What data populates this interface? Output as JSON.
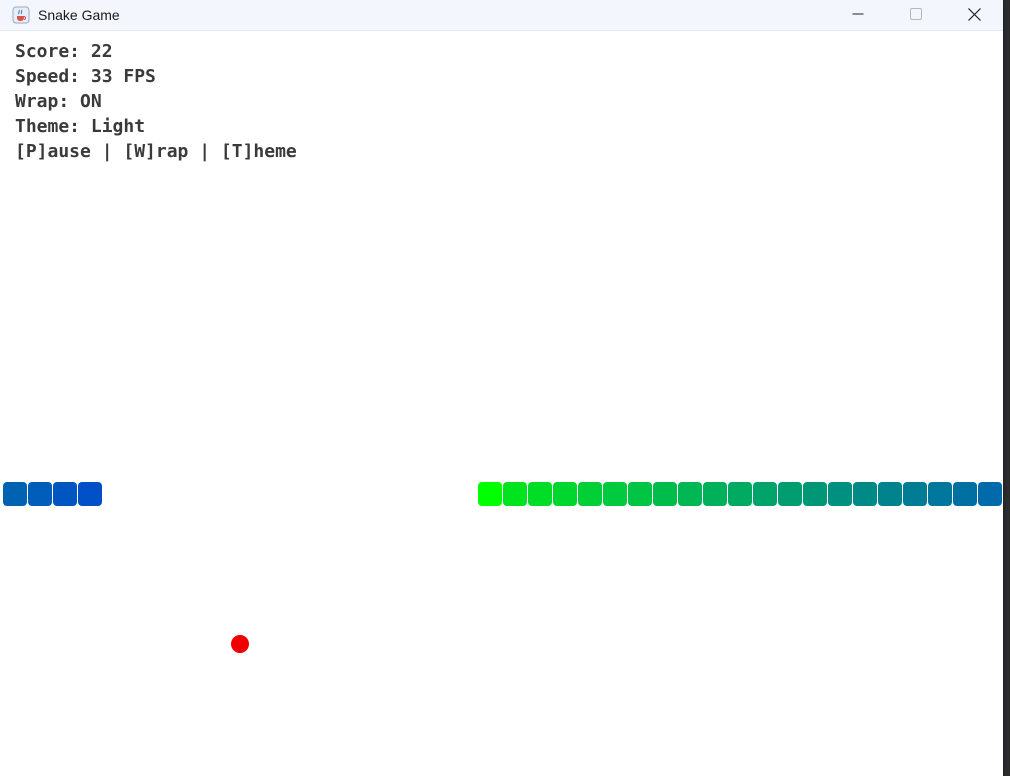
{
  "window": {
    "title": "Snake Game",
    "app_icon": "java-cup-icon",
    "controls": [
      "minimize-icon",
      "maximize-icon",
      "close-icon"
    ]
  },
  "hud": {
    "score_line": "Score: 22",
    "speed_line": "Speed: 33 FPS",
    "wrap_line": "Wrap: ON",
    "theme_line": "Theme: Light",
    "controls_line": "[P]ause | [W]rap | [T]heme"
  },
  "game": {
    "score": 22,
    "speed_fps": 33,
    "wrap": true,
    "theme": "Light",
    "snake_length": 25,
    "head_color": "#00ff00",
    "tail_color": "#0050c8",
    "food_color": "#f00000",
    "background": "#ffffff"
  }
}
